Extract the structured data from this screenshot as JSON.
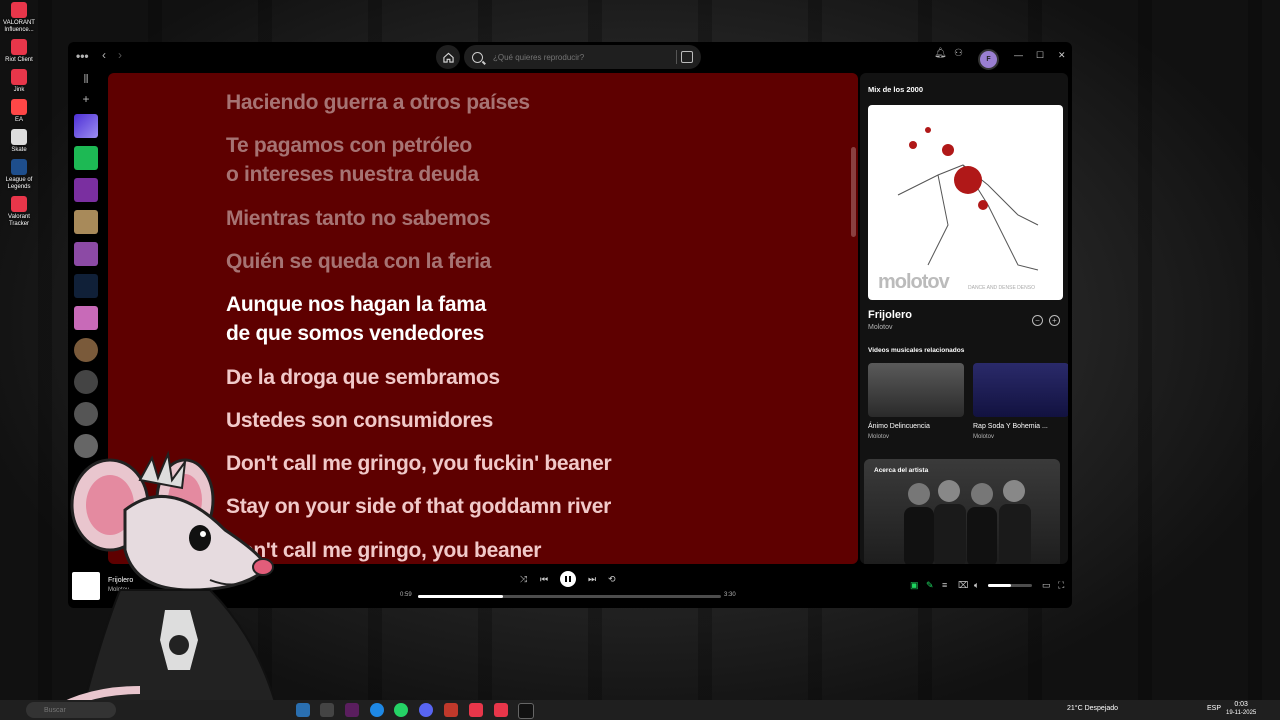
{
  "desktop": {
    "icons": [
      {
        "label": "VALORANT Influence...",
        "color": "#e8364a"
      },
      {
        "label": "Riot Client",
        "color": "#e8364a"
      },
      {
        "label": "Jink",
        "color": "#e8364a"
      },
      {
        "label": "EA",
        "color": "#ff4747"
      },
      {
        "label": "Skate",
        "color": "#dddddd"
      },
      {
        "label": "League of Legends",
        "color": "#1e4e8c"
      },
      {
        "label": "Valorant Tracker",
        "color": "#e8364a"
      }
    ]
  },
  "topbar": {
    "search_placeholder": "¿Qué quieres reproducir?",
    "avatar_letter": "F"
  },
  "lyrics": [
    {
      "text": "Haciendo guerra a otros países",
      "state": "past"
    },
    {
      "text": "Te pagamos con petróleo",
      "state": "past"
    },
    {
      "text": "o intereses nuestra deuda",
      "state": "past"
    },
    {
      "text": "Mientras tanto no sabemos",
      "state": "past"
    },
    {
      "text": "Quién se queda con la feria",
      "state": "past"
    },
    {
      "text": "Aunque nos hagan la fama",
      "state": "now"
    },
    {
      "text": "de que somos vendedores",
      "state": "now"
    },
    {
      "text": "De la droga que sembramos",
      "state": "next"
    },
    {
      "text": "Ustedes son consumidores",
      "state": "next"
    },
    {
      "text": "Don't call me gringo, you fuckin' beaner",
      "state": "next"
    },
    {
      "text": "Stay on your side of that goddamn river",
      "state": "next"
    },
    {
      "text": "Don't call me gringo, you beaner",
      "state": "next"
    }
  ],
  "right_panel": {
    "header": "Mix de los 2000",
    "cover_logo": "molotov",
    "cover_subtitle": "DANCE AND DENSE DENSO",
    "track_title": "Frijolero",
    "track_artist": "Molotov",
    "related_header": "Videos musicales relacionados",
    "videos": [
      {
        "title": "Ánimo Delincuencia",
        "artist": "Molotov"
      },
      {
        "title": "Rap Soda Y Bohemia ...",
        "artist": "Molotov"
      }
    ],
    "about_artist": "Acerca del artista"
  },
  "player": {
    "title": "Frijolero",
    "artist": "Molotov",
    "elapsed": "0:59",
    "duration": "3:30",
    "progress": 0.28,
    "volume": 0.52,
    "accent": "#1ed760"
  },
  "taskbar": {
    "search_placeholder": "Buscar",
    "weather": "21°C  Despejado",
    "language": "ESP",
    "time": "0:03",
    "date": "19-11-2025"
  }
}
